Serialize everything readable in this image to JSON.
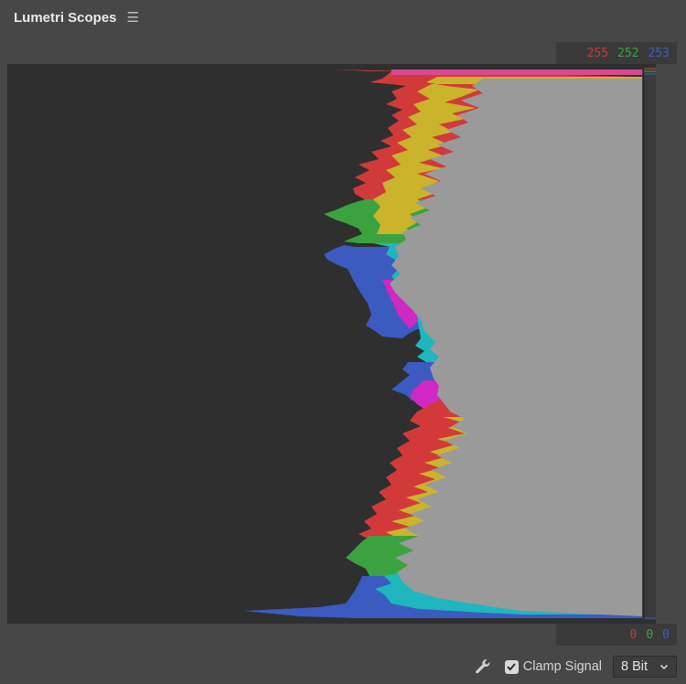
{
  "panel": {
    "title": "Lumetri Scopes",
    "menu_glyph": "☰"
  },
  "readout": {
    "top": {
      "r": "255",
      "g": "252",
      "b": "253"
    },
    "bottom": {
      "r": "0",
      "g": "0",
      "b": "0"
    }
  },
  "footer": {
    "settings_icon": "wrench-icon",
    "clamp_label": "Clamp Signal",
    "clamp_checked": true,
    "bit_depth": "8 Bit"
  },
  "colors": {
    "red": "#d23a3a",
    "green": "#3aa33f",
    "blue": "#3b5bc0",
    "yellow": "#c9b42c",
    "magenta": "#d028c2",
    "cyan": "#1fb6bd",
    "white_fill": "#9a9a9a"
  }
}
